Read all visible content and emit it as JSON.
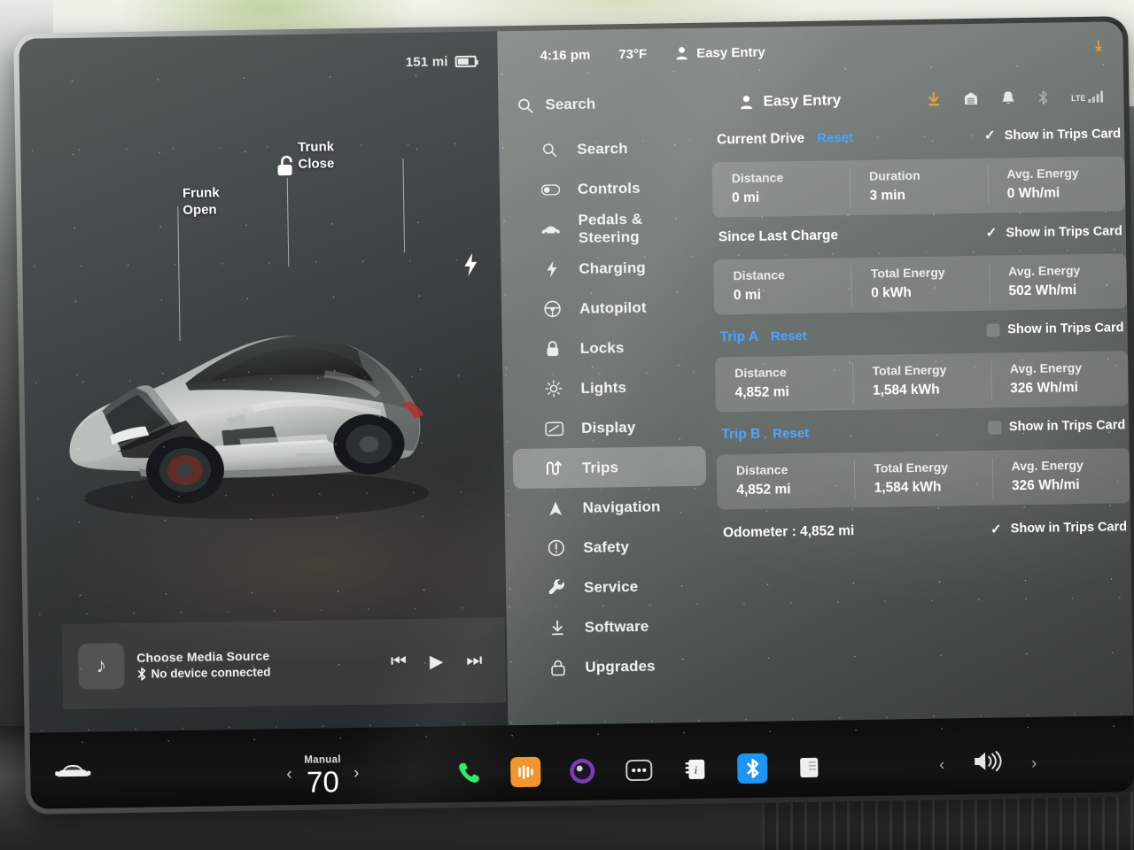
{
  "status_left": {
    "range": "151 mi",
    "battery_icon": "battery-icon"
  },
  "header": {
    "clock": "4:16 pm",
    "temperature": "73°F",
    "profile": "Easy Entry",
    "download_icon": "download-icon"
  },
  "search": {
    "placeholder": "Search",
    "icon": "search-icon"
  },
  "profile_row": {
    "name": "Easy Entry",
    "icon": "person-icon"
  },
  "sys_icons": [
    {
      "name": "download-icon",
      "glyph": "⤓"
    },
    {
      "name": "garage-icon",
      "glyph": "⌂"
    },
    {
      "name": "bell-icon",
      "glyph": "🔔"
    },
    {
      "name": "bluetooth-icon",
      "glyph": "ᛒ"
    },
    {
      "name": "lte-signal-icon",
      "glyph": "LTE"
    }
  ],
  "sidebar": {
    "items": [
      {
        "label": "Search",
        "icon": "search-icon"
      },
      {
        "label": "Controls",
        "icon": "toggle-icon"
      },
      {
        "label": "Pedals & Steering",
        "icon": "car-icon"
      },
      {
        "label": "Charging",
        "icon": "bolt-icon"
      },
      {
        "label": "Autopilot",
        "icon": "steering-wheel-icon"
      },
      {
        "label": "Locks",
        "icon": "lock-icon"
      },
      {
        "label": "Lights",
        "icon": "sun-icon"
      },
      {
        "label": "Display",
        "icon": "display-icon"
      },
      {
        "label": "Trips",
        "icon": "trips-icon",
        "active": true
      },
      {
        "label": "Navigation",
        "icon": "navigation-arrow-icon"
      },
      {
        "label": "Safety",
        "icon": "alert-circle-icon"
      },
      {
        "label": "Service",
        "icon": "wrench-icon"
      },
      {
        "label": "Software",
        "icon": "download-icon"
      },
      {
        "label": "Upgrades",
        "icon": "shopping-bag-icon"
      }
    ]
  },
  "car_panel": {
    "labels": [
      {
        "line1": "Frunk",
        "line2": "Open"
      },
      {
        "line1": "Trunk",
        "line2": "Close"
      }
    ],
    "lock_icon": "unlocked-padlock-icon",
    "charge_port_icon": "bolt-icon"
  },
  "media": {
    "title": "Choose Media Source",
    "subtitle": "No device connected",
    "bluetooth_icon": "bluetooth-icon",
    "note_icon": "music-note-icon",
    "prev_label": "⏮",
    "play_label": "▶",
    "next_label": "⏭"
  },
  "trips": {
    "show_label": "Show in Trips Card",
    "reset_label": "Reset",
    "sections": [
      {
        "title": "Current Drive",
        "has_reset": true,
        "title_blue": false,
        "checked": true,
        "cells": [
          {
            "label": "Distance",
            "value": "0 mi"
          },
          {
            "label": "Duration",
            "value": "3 min"
          },
          {
            "label": "Avg. Energy",
            "value": "0 Wh/mi"
          }
        ]
      },
      {
        "title": "Since Last Charge",
        "has_reset": false,
        "title_blue": false,
        "checked": true,
        "cells": [
          {
            "label": "Distance",
            "value": "0 mi"
          },
          {
            "label": "Total Energy",
            "value": "0 kWh"
          },
          {
            "label": "Avg. Energy",
            "value": "502 Wh/mi"
          }
        ]
      },
      {
        "title": "Trip A",
        "has_reset": true,
        "title_blue": true,
        "checked": false,
        "cells": [
          {
            "label": "Distance",
            "value": "4,852 mi"
          },
          {
            "label": "Total Energy",
            "value": "1,584 kWh"
          },
          {
            "label": "Avg. Energy",
            "value": "326 Wh/mi"
          }
        ]
      },
      {
        "title": "Trip B",
        "has_reset": true,
        "title_blue": true,
        "checked": false,
        "cells": [
          {
            "label": "Distance",
            "value": "4,852 mi"
          },
          {
            "label": "Total Energy",
            "value": "1,584 kWh"
          },
          {
            "label": "Avg. Energy",
            "value": "326 Wh/mi"
          }
        ]
      }
    ],
    "odometer": {
      "text": "Odometer :  4,852 mi",
      "checked": true
    }
  },
  "taskbar": {
    "car_icon": "car-front-icon",
    "climate": {
      "mode": "Manual",
      "temperature": "70",
      "left_arrow": "‹",
      "right_arrow": "›"
    },
    "apps": [
      {
        "name": "phone-app-icon",
        "color": "#2ee86a"
      },
      {
        "name": "media-app-icon",
        "color": "#f0962f"
      },
      {
        "name": "camera-app-icon",
        "color": "#7a3fb4"
      },
      {
        "name": "more-apps-icon",
        "color": "#d9dcd9"
      },
      {
        "name": "energy-app-icon",
        "color": "#f2f4f2"
      },
      {
        "name": "bluetooth-app-icon",
        "color": "#1f95f0"
      },
      {
        "name": "notes-app-icon",
        "color": "#eef0ee"
      }
    ],
    "volume": {
      "left_arrow": "‹",
      "right_arrow": "›",
      "icon": "speaker-icon"
    }
  },
  "colors": {
    "accent_blue": "#4aa3ff",
    "accent_orange": "#e8a33c",
    "panel": "#8a918d",
    "text": "#ffffff"
  }
}
